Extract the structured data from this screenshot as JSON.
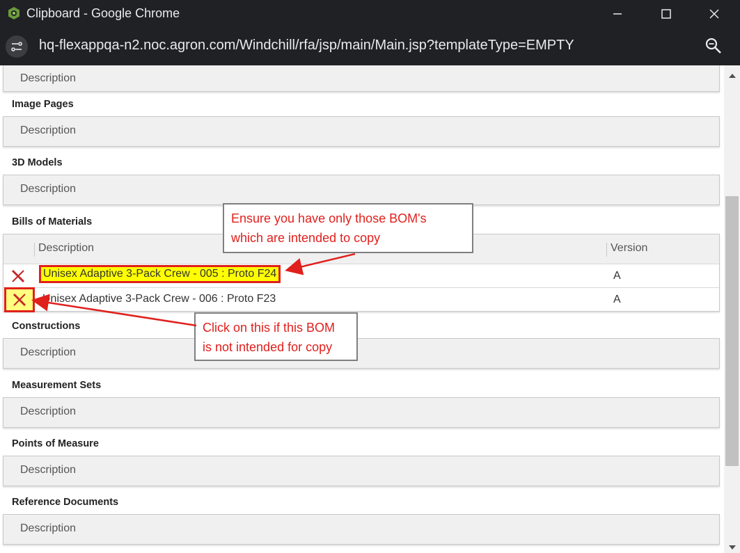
{
  "window": {
    "title": "Clipboard - Google Chrome",
    "url": "hq-flexappqa-n2.noc.agron.com/Windchill/rfa/jsp/main/Main.jsp?templateType=EMPTY"
  },
  "sections": {
    "top": {
      "desc_header": "Description"
    },
    "image_pages": {
      "label": "Image Pages",
      "desc_header": "Description"
    },
    "models_3d": {
      "label": "3D Models",
      "desc_header": "Description"
    },
    "boms": {
      "label": "Bills of Materials",
      "desc_header": "Description",
      "version_header": "Version",
      "rows": [
        {
          "description": "Unisex Adaptive 3-Pack Crew - 005 : Proto F24",
          "version": "A"
        },
        {
          "description": "Unisex Adaptive 3-Pack Crew - 006 : Proto F23",
          "version": "A"
        }
      ]
    },
    "constructions": {
      "label": "Constructions",
      "desc_header": "Description"
    },
    "measurement_sets": {
      "label": "Measurement Sets",
      "desc_header": "Description"
    },
    "points_of_measure": {
      "label": "Points of Measure",
      "desc_header": "Description"
    },
    "reference_documents": {
      "label": "Reference Documents",
      "desc_header": "Description"
    }
  },
  "annotations": {
    "callout1_line1": "Ensure you have only those BOM's",
    "callout1_line2": "which are intended to copy",
    "callout2_line1": "Click on this if this BOM",
    "callout2_line2": "is not intended for copy"
  },
  "colors": {
    "annotation_red": "#e0201c",
    "highlight_yellow": "#ffff00",
    "titlebar": "#202124"
  }
}
